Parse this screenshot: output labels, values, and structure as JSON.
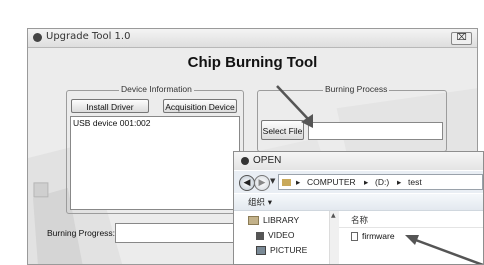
{
  "main_window": {
    "title": "Upgrade Tool 1.0",
    "close_label": "⌧",
    "heading": "Chip Burning Tool",
    "device_info": {
      "group_label": "Device Information",
      "install_driver_label": "Install Driver",
      "acquisition_device_label": "Acquisition Device",
      "devices": [
        "USB device 001:002"
      ]
    },
    "burning_process": {
      "group_label": "Burning Process",
      "select_file_label": "Select  File",
      "file_path_value": ""
    },
    "burning_progress_label": "Burning Progress:"
  },
  "open_dialog": {
    "title": "OPEN",
    "breadcrumb": [
      "COMPUTER",
      "(D:)",
      "test"
    ],
    "organize_label": "组织 ▾",
    "nav_items": [
      {
        "label": "LIBRARY",
        "icon": "library-icon"
      },
      {
        "label": "VIDEO",
        "icon": "video-icon"
      },
      {
        "label": "PICTURE",
        "icon": "picture-icon"
      }
    ],
    "column_name_label": "名称",
    "files": [
      "firmware"
    ]
  }
}
